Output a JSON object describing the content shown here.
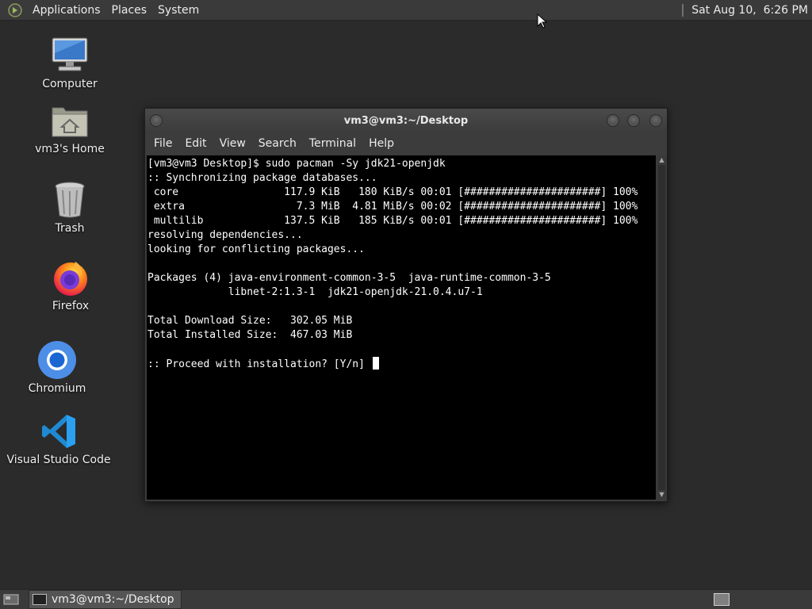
{
  "top_panel": {
    "menus": [
      "Applications",
      "Places",
      "System"
    ],
    "clock": "Sat Aug 10,  6:26 PM"
  },
  "desktop_icons": {
    "computer": "Computer",
    "home": "vm3's Home",
    "trash": "Trash",
    "firefox": "Firefox",
    "chromium": "Chromium",
    "vscode": "Visual Studio Code"
  },
  "window": {
    "title": "vm3@vm3:~/Desktop",
    "menu": [
      "File",
      "Edit",
      "View",
      "Search",
      "Terminal",
      "Help"
    ]
  },
  "terminal": {
    "lines": [
      "[vm3@vm3 Desktop]$ sudo pacman -Sy jdk21-openjdk",
      ":: Synchronizing package databases...",
      " core                 117.9 KiB   180 KiB/s 00:01 [######################] 100%",
      " extra                  7.3 MiB  4.81 MiB/s 00:02 [######################] 100%",
      " multilib             137.5 KiB   185 KiB/s 00:01 [######################] 100%",
      "resolving dependencies...",
      "looking for conflicting packages...",
      "",
      "Packages (4) java-environment-common-3-5  java-runtime-common-3-5",
      "             libnet-2:1.3-1  jdk21-openjdk-21.0.4.u7-1",
      "",
      "Total Download Size:   302.05 MiB",
      "Total Installed Size:  467.03 MiB",
      ""
    ],
    "prompt": ":: Proceed with installation? [Y/n] "
  },
  "taskbar": {
    "task_label": "vm3@vm3:~/Desktop"
  }
}
